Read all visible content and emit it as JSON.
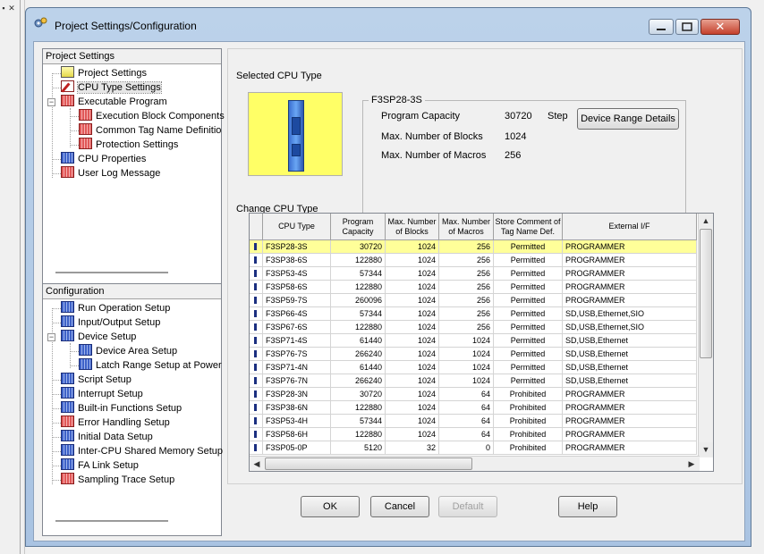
{
  "window": {
    "title": "Project Settings/Configuration"
  },
  "project_settings": {
    "header": "Project Settings",
    "items": [
      {
        "label": "Project Settings"
      },
      {
        "label": "CPU Type Settings"
      },
      {
        "label": "Executable Program"
      },
      {
        "label": "Execution Block Components"
      },
      {
        "label": "Common Tag Name Definitions"
      },
      {
        "label": "Protection Settings"
      },
      {
        "label": "CPU Properties"
      },
      {
        "label": "User Log Message"
      }
    ]
  },
  "configuration": {
    "header": "Configuration",
    "items": [
      {
        "label": "Run Operation Setup"
      },
      {
        "label": "Input/Output Setup"
      },
      {
        "label": "Device Setup"
      },
      {
        "label": "Device Area Setup"
      },
      {
        "label": "Latch Range Setup at Power"
      },
      {
        "label": "Script Setup"
      },
      {
        "label": "Interrupt Setup"
      },
      {
        "label": "Built-in Functions Setup"
      },
      {
        "label": "Error Handling Setup"
      },
      {
        "label": "Initial Data Setup"
      },
      {
        "label": "Inter-CPU Shared Memory Setup"
      },
      {
        "label": "FA Link Setup"
      },
      {
        "label": "Sampling Trace Setup"
      }
    ]
  },
  "selected_cpu": {
    "heading": "Selected CPU Type",
    "group_title": "F3SP28-3S",
    "program_capacity_label": "Program Capacity",
    "program_capacity_value": "30720",
    "program_capacity_unit": "Step",
    "max_blocks_label": "Max. Number of Blocks",
    "max_blocks_value": "1024",
    "max_macros_label": "Max. Number of Macros",
    "max_macros_value": "256",
    "device_range_button": "Device Range Details"
  },
  "change_cpu": {
    "heading": "Change CPU Type",
    "columns": [
      "CPU Type",
      "Program Capacity",
      "Max. Number of Blocks",
      "Max. Number of Macros",
      "Store Comment of Tag Name Def.",
      "External I/F"
    ],
    "rows": [
      [
        "F3SP28-3S",
        "30720",
        "1024",
        "256",
        "Permitted",
        "PROGRAMMER"
      ],
      [
        "F3SP38-6S",
        "122880",
        "1024",
        "256",
        "Permitted",
        "PROGRAMMER"
      ],
      [
        "F3SP53-4S",
        "57344",
        "1024",
        "256",
        "Permitted",
        "PROGRAMMER"
      ],
      [
        "F3SP58-6S",
        "122880",
        "1024",
        "256",
        "Permitted",
        "PROGRAMMER"
      ],
      [
        "F3SP59-7S",
        "260096",
        "1024",
        "256",
        "Permitted",
        "PROGRAMMER"
      ],
      [
        "F3SP66-4S",
        "57344",
        "1024",
        "256",
        "Permitted",
        "SD,USB,Ethernet,SIO"
      ],
      [
        "F3SP67-6S",
        "122880",
        "1024",
        "256",
        "Permitted",
        "SD,USB,Ethernet,SIO"
      ],
      [
        "F3SP71-4S",
        "61440",
        "1024",
        "1024",
        "Permitted",
        "SD,USB,Ethernet"
      ],
      [
        "F3SP76-7S",
        "266240",
        "1024",
        "1024",
        "Permitted",
        "SD,USB,Ethernet"
      ],
      [
        "F3SP71-4N",
        "61440",
        "1024",
        "1024",
        "Permitted",
        "SD,USB,Ethernet"
      ],
      [
        "F3SP76-7N",
        "266240",
        "1024",
        "1024",
        "Permitted",
        "SD,USB,Ethernet"
      ],
      [
        "F3SP28-3N",
        "30720",
        "1024",
        "64",
        "Prohibited",
        "PROGRAMMER"
      ],
      [
        "F3SP38-6N",
        "122880",
        "1024",
        "64",
        "Prohibited",
        "PROGRAMMER"
      ],
      [
        "F3SP53-4H",
        "57344",
        "1024",
        "64",
        "Prohibited",
        "PROGRAMMER"
      ],
      [
        "F3SP58-6H",
        "122880",
        "1024",
        "64",
        "Prohibited",
        "PROGRAMMER"
      ],
      [
        "F3SP05-0P",
        "5120",
        "32",
        "0",
        "Prohibited",
        "PROGRAMMER"
      ]
    ]
  },
  "buttons": {
    "ok": "OK",
    "cancel": "Cancel",
    "default": "Default",
    "help": "Help"
  },
  "colors": {
    "selected_row": "#ffff99",
    "cpu_image_bg": "#ffff66",
    "titlebar": "#bcd2ea"
  }
}
